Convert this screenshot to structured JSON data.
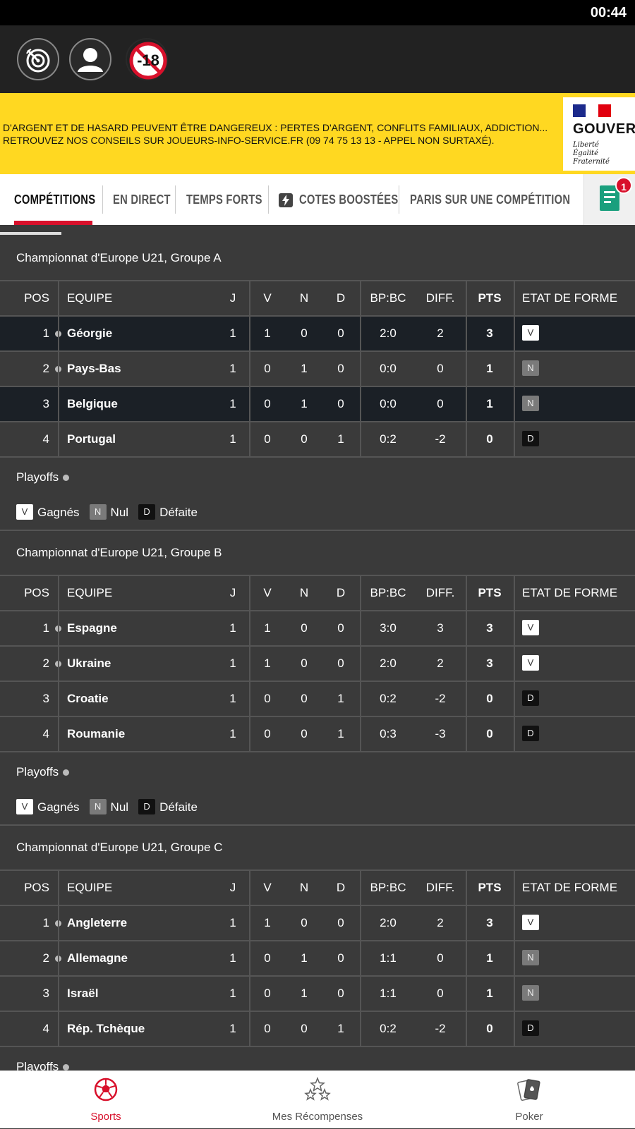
{
  "status_bar": {
    "time": "00:44"
  },
  "top_icons": [
    "target-icon",
    "user-icon",
    "minus-18-icon"
  ],
  "top_icons_text": {
    "age": "-18"
  },
  "banner": {
    "line1": "D'ARGENT ET DE HASARD PEUVENT ÊTRE DANGEREUX : PERTES D'ARGENT, CONFLITS FAMILIAUX, ADDICTION...",
    "line2": " RETROUVEZ NOS CONSEILS SUR JOUEURS-INFO-SERVICE.FR (09 74 75 13 13 - APPEL NON SURTAXÉ).",
    "gov_name": "GOUVERNEMENT",
    "gov_motto1": "Liberté",
    "gov_motto2": "Égalité",
    "gov_motto3": "Fraternité"
  },
  "tabs": [
    {
      "label": "COMPÉTITIONS",
      "active": true
    },
    {
      "label": "EN DIRECT"
    },
    {
      "label": "TEMPS FORTS"
    },
    {
      "label": "COTES BOOSTÉES"
    },
    {
      "label": "PARIS SUR UNE COMPÉTITION"
    }
  ],
  "betslip": {
    "count": "1"
  },
  "headers": {
    "pos": "POS",
    "team": "EQUIPE",
    "j": "J",
    "v": "V",
    "n": "N",
    "d": "D",
    "bp": "BP:BC",
    "diff": "DIFF.",
    "pts": "PTS",
    "form": "ETAT DE FORME"
  },
  "playoffs_label": "Playoffs",
  "legend": {
    "v_badge": "V",
    "v_text": "Gagnés",
    "n_badge": "N",
    "n_text": "Nul",
    "d_badge": "D",
    "d_text": "Défaite"
  },
  "groups": [
    {
      "title": "Championnat d'Europe U21, Groupe A",
      "rows": [
        {
          "pos": "1",
          "team": "Géorgie",
          "j": "1",
          "v": "1",
          "n": "0",
          "d": "0",
          "bp": "2:0",
          "diff": "2",
          "pts": "3",
          "form": "V"
        },
        {
          "pos": "2",
          "team": "Pays-Bas",
          "j": "1",
          "v": "0",
          "n": "1",
          "d": "0",
          "bp": "0:0",
          "diff": "0",
          "pts": "1",
          "form": "N"
        },
        {
          "pos": "3",
          "team": "Belgique",
          "j": "1",
          "v": "0",
          "n": "1",
          "d": "0",
          "bp": "0:0",
          "diff": "0",
          "pts": "1",
          "form": "N"
        },
        {
          "pos": "4",
          "team": "Portugal",
          "j": "1",
          "v": "0",
          "n": "0",
          "d": "1",
          "bp": "0:2",
          "diff": "-2",
          "pts": "0",
          "form": "D"
        }
      ]
    },
    {
      "title": "Championnat d'Europe U21, Groupe B",
      "rows": [
        {
          "pos": "1",
          "team": "Espagne",
          "j": "1",
          "v": "1",
          "n": "0",
          "d": "0",
          "bp": "3:0",
          "diff": "3",
          "pts": "3",
          "form": "V"
        },
        {
          "pos": "2",
          "team": "Ukraine",
          "j": "1",
          "v": "1",
          "n": "0",
          "d": "0",
          "bp": "2:0",
          "diff": "2",
          "pts": "3",
          "form": "V"
        },
        {
          "pos": "3",
          "team": "Croatie",
          "j": "1",
          "v": "0",
          "n": "0",
          "d": "1",
          "bp": "0:2",
          "diff": "-2",
          "pts": "0",
          "form": "D"
        },
        {
          "pos": "4",
          "team": "Roumanie",
          "j": "1",
          "v": "0",
          "n": "0",
          "d": "1",
          "bp": "0:3",
          "diff": "-3",
          "pts": "0",
          "form": "D"
        }
      ]
    },
    {
      "title": "Championnat d'Europe U21, Groupe C",
      "rows": [
        {
          "pos": "1",
          "team": "Angleterre",
          "j": "1",
          "v": "1",
          "n": "0",
          "d": "0",
          "bp": "2:0",
          "diff": "2",
          "pts": "3",
          "form": "V"
        },
        {
          "pos": "2",
          "team": "Allemagne",
          "j": "1",
          "v": "0",
          "n": "1",
          "d": "0",
          "bp": "1:1",
          "diff": "0",
          "pts": "1",
          "form": "N"
        },
        {
          "pos": "3",
          "team": "Israël",
          "j": "1",
          "v": "0",
          "n": "1",
          "d": "0",
          "bp": "1:1",
          "diff": "0",
          "pts": "1",
          "form": "N"
        },
        {
          "pos": "4",
          "team": "Rép. Tchèque",
          "j": "1",
          "v": "0",
          "n": "0",
          "d": "1",
          "bp": "0:2",
          "diff": "-2",
          "pts": "0",
          "form": "D"
        }
      ]
    }
  ],
  "bottom_nav": [
    {
      "label": "Sports",
      "icon": "soccer-ball-icon",
      "active": true
    },
    {
      "label": "Mes Récompenses",
      "icon": "stars-icon"
    },
    {
      "label": "Poker",
      "icon": "cards-icon"
    }
  ],
  "colors": {
    "accent": "#d8102b",
    "banner": "#ffd821",
    "highlight_row": "#1b2026"
  }
}
